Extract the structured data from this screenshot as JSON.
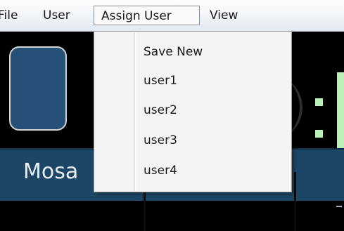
{
  "menubar": {
    "items": [
      {
        "label": "File"
      },
      {
        "label": "User"
      },
      {
        "label": "Assign User"
      },
      {
        "label": "View"
      }
    ]
  },
  "assign_user_menu": {
    "items": [
      {
        "label": "Save New"
      },
      {
        "label": "user1"
      },
      {
        "label": "user2"
      },
      {
        "label": "user3"
      },
      {
        "label": "user4"
      }
    ]
  },
  "app": {
    "tab_label": "Mosa"
  },
  "colors": {
    "app_background": "#000000",
    "panel_blue": "#265077",
    "toolbar_blue": "#1c4666",
    "clock_digit_green": "#b8f0b8",
    "menu_background": "#f4f4f4"
  }
}
